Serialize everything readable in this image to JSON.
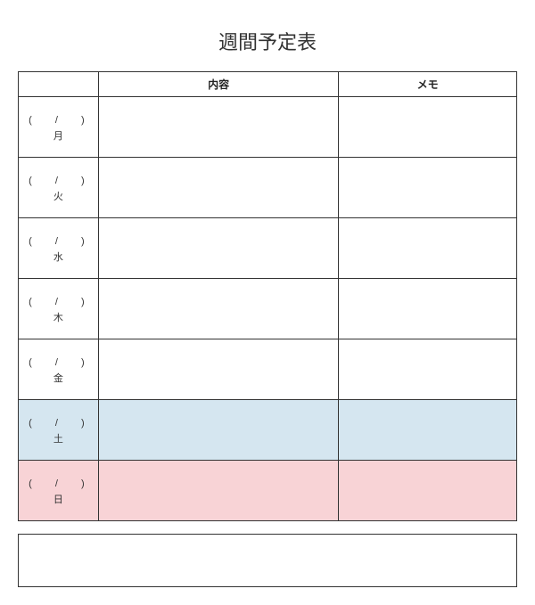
{
  "title": "週間予定表",
  "headers": {
    "day": "",
    "content": "内容",
    "memo": "メモ"
  },
  "date_template": "(　 / 　)",
  "days": [
    {
      "jp": "月",
      "class": ""
    },
    {
      "jp": "火",
      "class": ""
    },
    {
      "jp": "水",
      "class": ""
    },
    {
      "jp": "木",
      "class": ""
    },
    {
      "jp": "金",
      "class": ""
    },
    {
      "jp": "土",
      "class": "row-sat"
    },
    {
      "jp": "日",
      "class": "row-sun"
    }
  ]
}
